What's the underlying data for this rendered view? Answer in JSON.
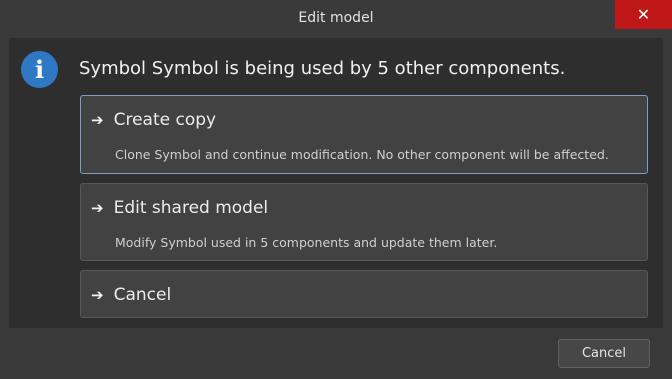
{
  "window": {
    "title": "Edit model",
    "close_glyph": "✕"
  },
  "message": "Symbol Symbol is being used by 5 other components.",
  "info_icon": {
    "name": "info-icon",
    "glyph": "i",
    "color": "#2f78c4"
  },
  "options": [
    {
      "title": "Create copy",
      "description": "Clone Symbol and continue modification. No other component will be affected.",
      "selected": true
    },
    {
      "title": "Edit shared model",
      "description": "Modify Symbol used in 5 components and update them later.",
      "selected": false
    },
    {
      "title": "Cancel",
      "description": "",
      "selected": false
    }
  ],
  "arrow_glyph": "➔",
  "footer": {
    "cancel_label": "Cancel"
  },
  "colors": {
    "close_button": "#c01818",
    "selected_border": "#7f9ec3"
  }
}
